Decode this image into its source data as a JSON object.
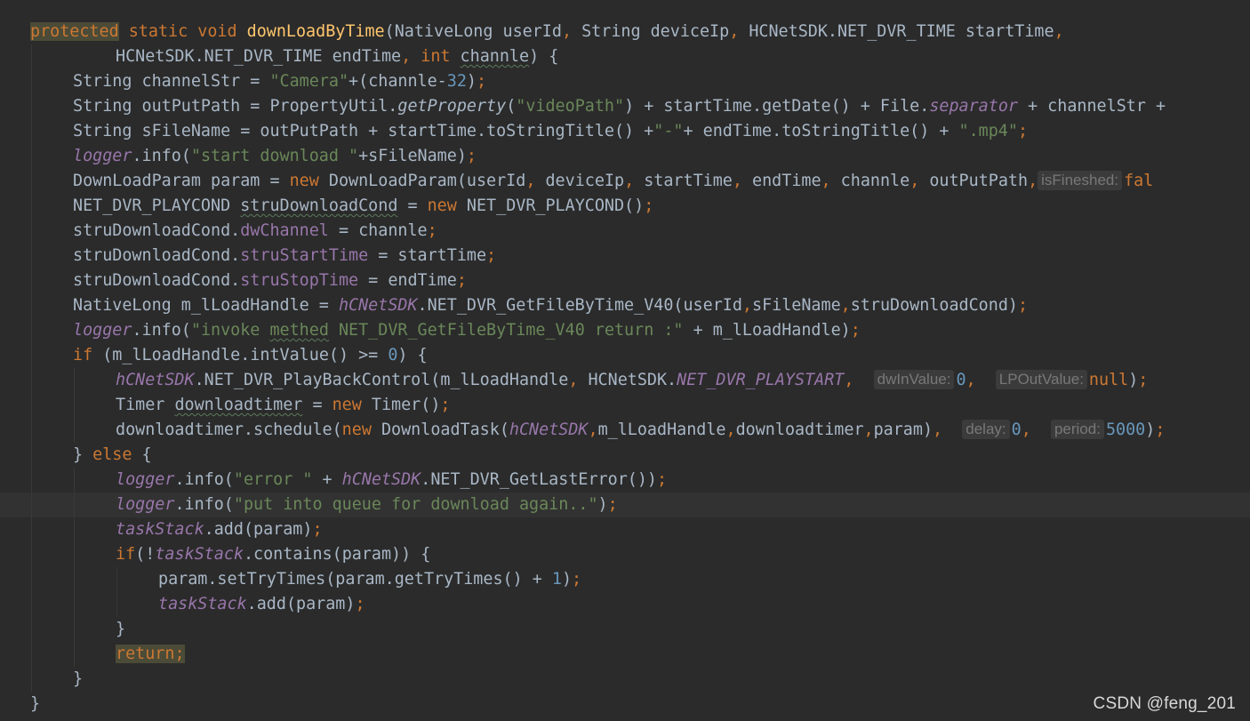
{
  "watermark": "CSDN @feng_201",
  "hints": {
    "is_fineshed": "isFineshed:",
    "dw_in_value": "dwInValue:",
    "lp_out_value": "LPOutValue:",
    "delay": "delay:",
    "period": "period:"
  },
  "code": {
    "l1": {
      "t1": "protected",
      "t2": " ",
      "t3": "static",
      "t4": " ",
      "t5": "void",
      "t6": " ",
      "t7": "downLoadByTime",
      "t8": "(NativeLong userId",
      "t9": ",",
      "t10": " String deviceIp",
      "t11": ",",
      "t12": " HCNetSDK.NET_DVR_TIME startTime",
      "t13": ","
    },
    "l2": {
      "t1": "HCNetSDK.NET_DVR_TIME endTime",
      "t2": ",",
      "t3": " ",
      "t4": "int",
      "t5": " ",
      "t6": "channle",
      "t7": ") {"
    },
    "l3": {
      "t1": "String channelStr = ",
      "t2": "\"Camera\"",
      "t3": "+(channle-",
      "t4": "32",
      "t5": ")",
      "t6": ";"
    },
    "l4": {
      "t1": "String outPutPath = PropertyUtil.",
      "t2": "getProperty",
      "t3": "(",
      "t4": "\"videoPath\"",
      "t5": ") + startTime.getDate() + File.",
      "t6": "separator",
      "t7": " + channelStr + "
    },
    "l5": {
      "t1": "String sFileName = outPutPath + startTime.toStringTitle() +",
      "t2": "\"-\"",
      "t3": "+ endTime.toStringTitle() + ",
      "t4": "\".mp4\"",
      "t5": ";"
    },
    "l6": {
      "t1": "logger",
      "t2": ".info(",
      "t3": "\"start download \"",
      "t4": "+sFileName)",
      "t5": ";"
    },
    "l7": {
      "t1": "DownLoadParam param = ",
      "t2": "new",
      "t3": " DownLoadParam(userId",
      "t4": ",",
      "t5": " deviceIp",
      "t6": ",",
      "t7": " startTime",
      "t8": ",",
      "t9": " endTime",
      "t10": ",",
      "t11": " channle",
      "t12": ",",
      "t13": " outPutPath",
      "t14": ",",
      "t16": "fal"
    },
    "l8": {
      "t1": "NET_DVR_PLAYCOND ",
      "t2": "struDownloadCond",
      "t3": " = ",
      "t4": "new",
      "t5": " NET_DVR_PLAYCOND()",
      "t6": ";"
    },
    "l9": {
      "t1": "struDownloadCond.",
      "t2": "dwChannel",
      "t3": " = channle",
      "t4": ";"
    },
    "l10": {
      "t1": "struDownloadCond.",
      "t2": "struStartTime",
      "t3": " = startTime",
      "t4": ";"
    },
    "l11": {
      "t1": "struDownloadCond.",
      "t2": "struStopTime",
      "t3": " = endTime",
      "t4": ";"
    },
    "l12": {
      "t1": "NativeLong m_lLoadHandle = ",
      "t2": "hCNetSDK",
      "t3": ".NET_DVR_GetFileByTime_V40(userId",
      "t4": ",",
      "t5": "sFileName",
      "t6": ",",
      "t7": "struDownloadCond)",
      "t8": ";"
    },
    "l13": {
      "t1": "logger",
      "t2": ".info(",
      "t3": "\"invoke ",
      "t4": "methed",
      "t5": " NET_DVR_GetFileByTime_V40 return :\"",
      "t6": " + m_lLoadHandle)",
      "t7": ";"
    },
    "l14": {
      "t1": "if",
      "t2": " (m_lLoadHandle.intValue() >= ",
      "t3": "0",
      "t4": ") {"
    },
    "l15": {
      "t1": "hCNetSDK",
      "t2": ".NET_DVR_PlayBackControl(m_lLoadHandle",
      "t3": ",",
      "t4": " HCNetSDK.",
      "t5": "NET_DVR_PLAYSTART",
      "t6": ",",
      "t7": "  ",
      "t9": "0",
      "t10": ",",
      "t11": "  ",
      "t13": "null",
      "t14": ")",
      "t15": ";"
    },
    "l16": {
      "t1": "Timer ",
      "t2": "downloadtimer",
      "t3": " = ",
      "t4": "new",
      "t5": " Timer()",
      "t6": ";"
    },
    "l17": {
      "t1": "downloadtimer.schedule(",
      "t2": "new",
      "t3": " DownloadTask(",
      "t4": "hCNetSDK",
      "t5": ",",
      "t6": "m_lLoadHandle",
      "t7": ",",
      "t8": "downloadtimer",
      "t9": ",",
      "t10": "param)",
      "t11": ",",
      "t12": "  ",
      "t14": "0",
      "t15": ",",
      "t16": "  ",
      "t18": "5000",
      "t19": ")",
      "t20": ";"
    },
    "l18": {
      "t1": "} ",
      "t2": "else",
      "t3": " {"
    },
    "l19": {
      "t1": "logger",
      "t2": ".info(",
      "t3": "\"error \"",
      "t4": " + ",
      "t5": "hCNetSDK",
      "t6": ".NET_DVR_GetLastError())",
      "t7": ";"
    },
    "l20": {
      "t1": "logger",
      "t2": ".info(",
      "t3": "\"put into queue for download again..\"",
      "t4": ")",
      "t5": ";"
    },
    "l21": {
      "t1": "taskStack",
      "t2": ".add(param)",
      "t3": ";"
    },
    "l22": {
      "t1": "if",
      "t2": "(!",
      "t3": "taskStack",
      "t4": ".contains(param)) {"
    },
    "l23": {
      "t1": "param.setTryTimes(param.getTryTimes() + ",
      "t2": "1",
      "t3": ")",
      "t4": ";"
    },
    "l24": {
      "t1": "taskStack",
      "t2": ".add(param)",
      "t3": ";"
    },
    "l25": {
      "t1": "}"
    },
    "l26": {
      "t1": "return",
      "t2": ";"
    },
    "l27": {
      "t1": "}"
    },
    "l28": {
      "t1": "}"
    }
  }
}
